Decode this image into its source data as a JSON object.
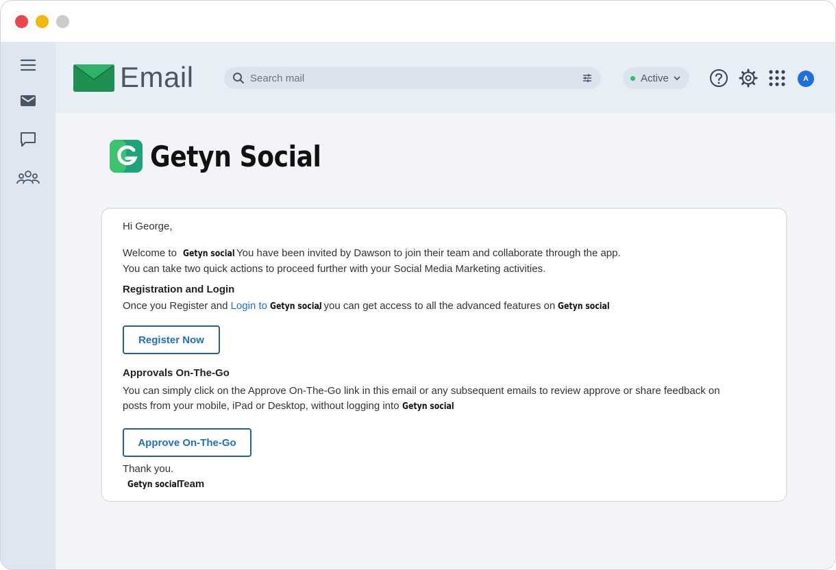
{
  "header": {
    "app_name": "Email",
    "search_placeholder": "Search mail",
    "status_label": "Active",
    "avatar_initial": "A"
  },
  "email": {
    "brand_name": "Getyn Social",
    "greeting": "Hi George,",
    "intro_prefix": "Welcome to",
    "intro_brand": "Getyn social",
    "intro_suffix": "You have been invited by Dawson to join their team and collaborate through the app.",
    "intro_line2": "You can take two quick actions to proceed further with your Social Media Marketing activities.",
    "registration_heading": "Registration and Login",
    "registration_prefix": "Once you Register and",
    "registration_link": "Login to",
    "registration_brand": "Getyn social",
    "registration_middle": ", you can get access to all the advanced features on",
    "registration_brand2": "Getyn social",
    "register_button": "Register Now",
    "approvals_heading": "Approvals On-The-Go",
    "approvals_line1": "You can simply click on the Approve On-The-Go link in this email or any subsequent emails to review approve or share feedback on",
    "approvals_line2_prefix": "posts from your mobile, iPad or Desktop, without logging into",
    "approvals_brand": "Getyn social",
    "approve_button": "Approve On-The-Go",
    "thanks": "Thank you.",
    "signature_brand": "Getyn social",
    "signature_suffix": "Team"
  },
  "colors": {
    "sidebar_bg": "#dde6f1",
    "header_bg": "#e8eef6",
    "accent_blue": "#1f6fc9",
    "status_green": "#22c55e",
    "logo_green": "#1f9e5a"
  },
  "icons": {
    "sidebar": [
      "menu-icon",
      "mail-icon",
      "chat-icon",
      "contacts-icon"
    ],
    "header": [
      "search-icon",
      "filter-icon",
      "chevron-down-icon",
      "help-icon",
      "gear-icon",
      "apps-grid-icon"
    ]
  }
}
